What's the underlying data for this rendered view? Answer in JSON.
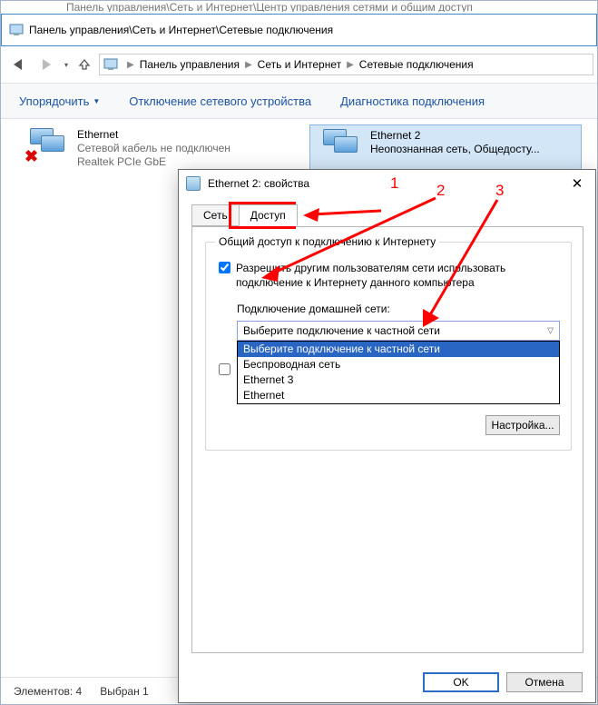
{
  "bg_window": {
    "title_stub": "Панель управления\\Сеть и Интернет\\Центр управления сетями и общим доступ",
    "title": "Панель управления\\Сеть и Интернет\\Сетевые подключения",
    "breadcrumbs": [
      "Панель управления",
      "Сеть и Интернет",
      "Сетевые подключения"
    ],
    "toolbar": {
      "organize": "Упорядочить",
      "disable": "Отключение сетевого устройства",
      "diag": "Диагностика подключения"
    },
    "connections": [
      {
        "name": "Ethernet",
        "line2": "Сетевой кабель не подключен",
        "line3": "Realtek PCIe GbE",
        "selected": false,
        "disconnected": true
      },
      {
        "name": "Ethernet 2",
        "line2": "Неопознанная сеть, Общедосту...",
        "line3": "",
        "selected": true,
        "disconnected": false
      }
    ],
    "status": {
      "elements": "Элементов: 4",
      "selected": "Выбран 1"
    }
  },
  "dialog": {
    "title": "Ethernet 2: свойства",
    "close": "✕",
    "tabs": {
      "network": "Сеть",
      "access": "Доступ"
    },
    "group_legend": "Общий доступ к подключению к Интернету",
    "chk_allow": "Разрешить другим пользователям сети использовать подключение к Интернету данного компьютера",
    "home_label": "Подключение домашней сети:",
    "combo_value": "Выберите подключение к частной сети",
    "combo_options": [
      "Выберите подключение к частной сети",
      "Беспроводная сеть",
      "Ethernet 3",
      "Ethernet"
    ],
    "chk_allow_control": "",
    "settings_btn": "Настройка...",
    "ok": "OK",
    "cancel": "Отмена"
  },
  "annotations": {
    "n1": "1",
    "n2": "2",
    "n3": "3"
  }
}
